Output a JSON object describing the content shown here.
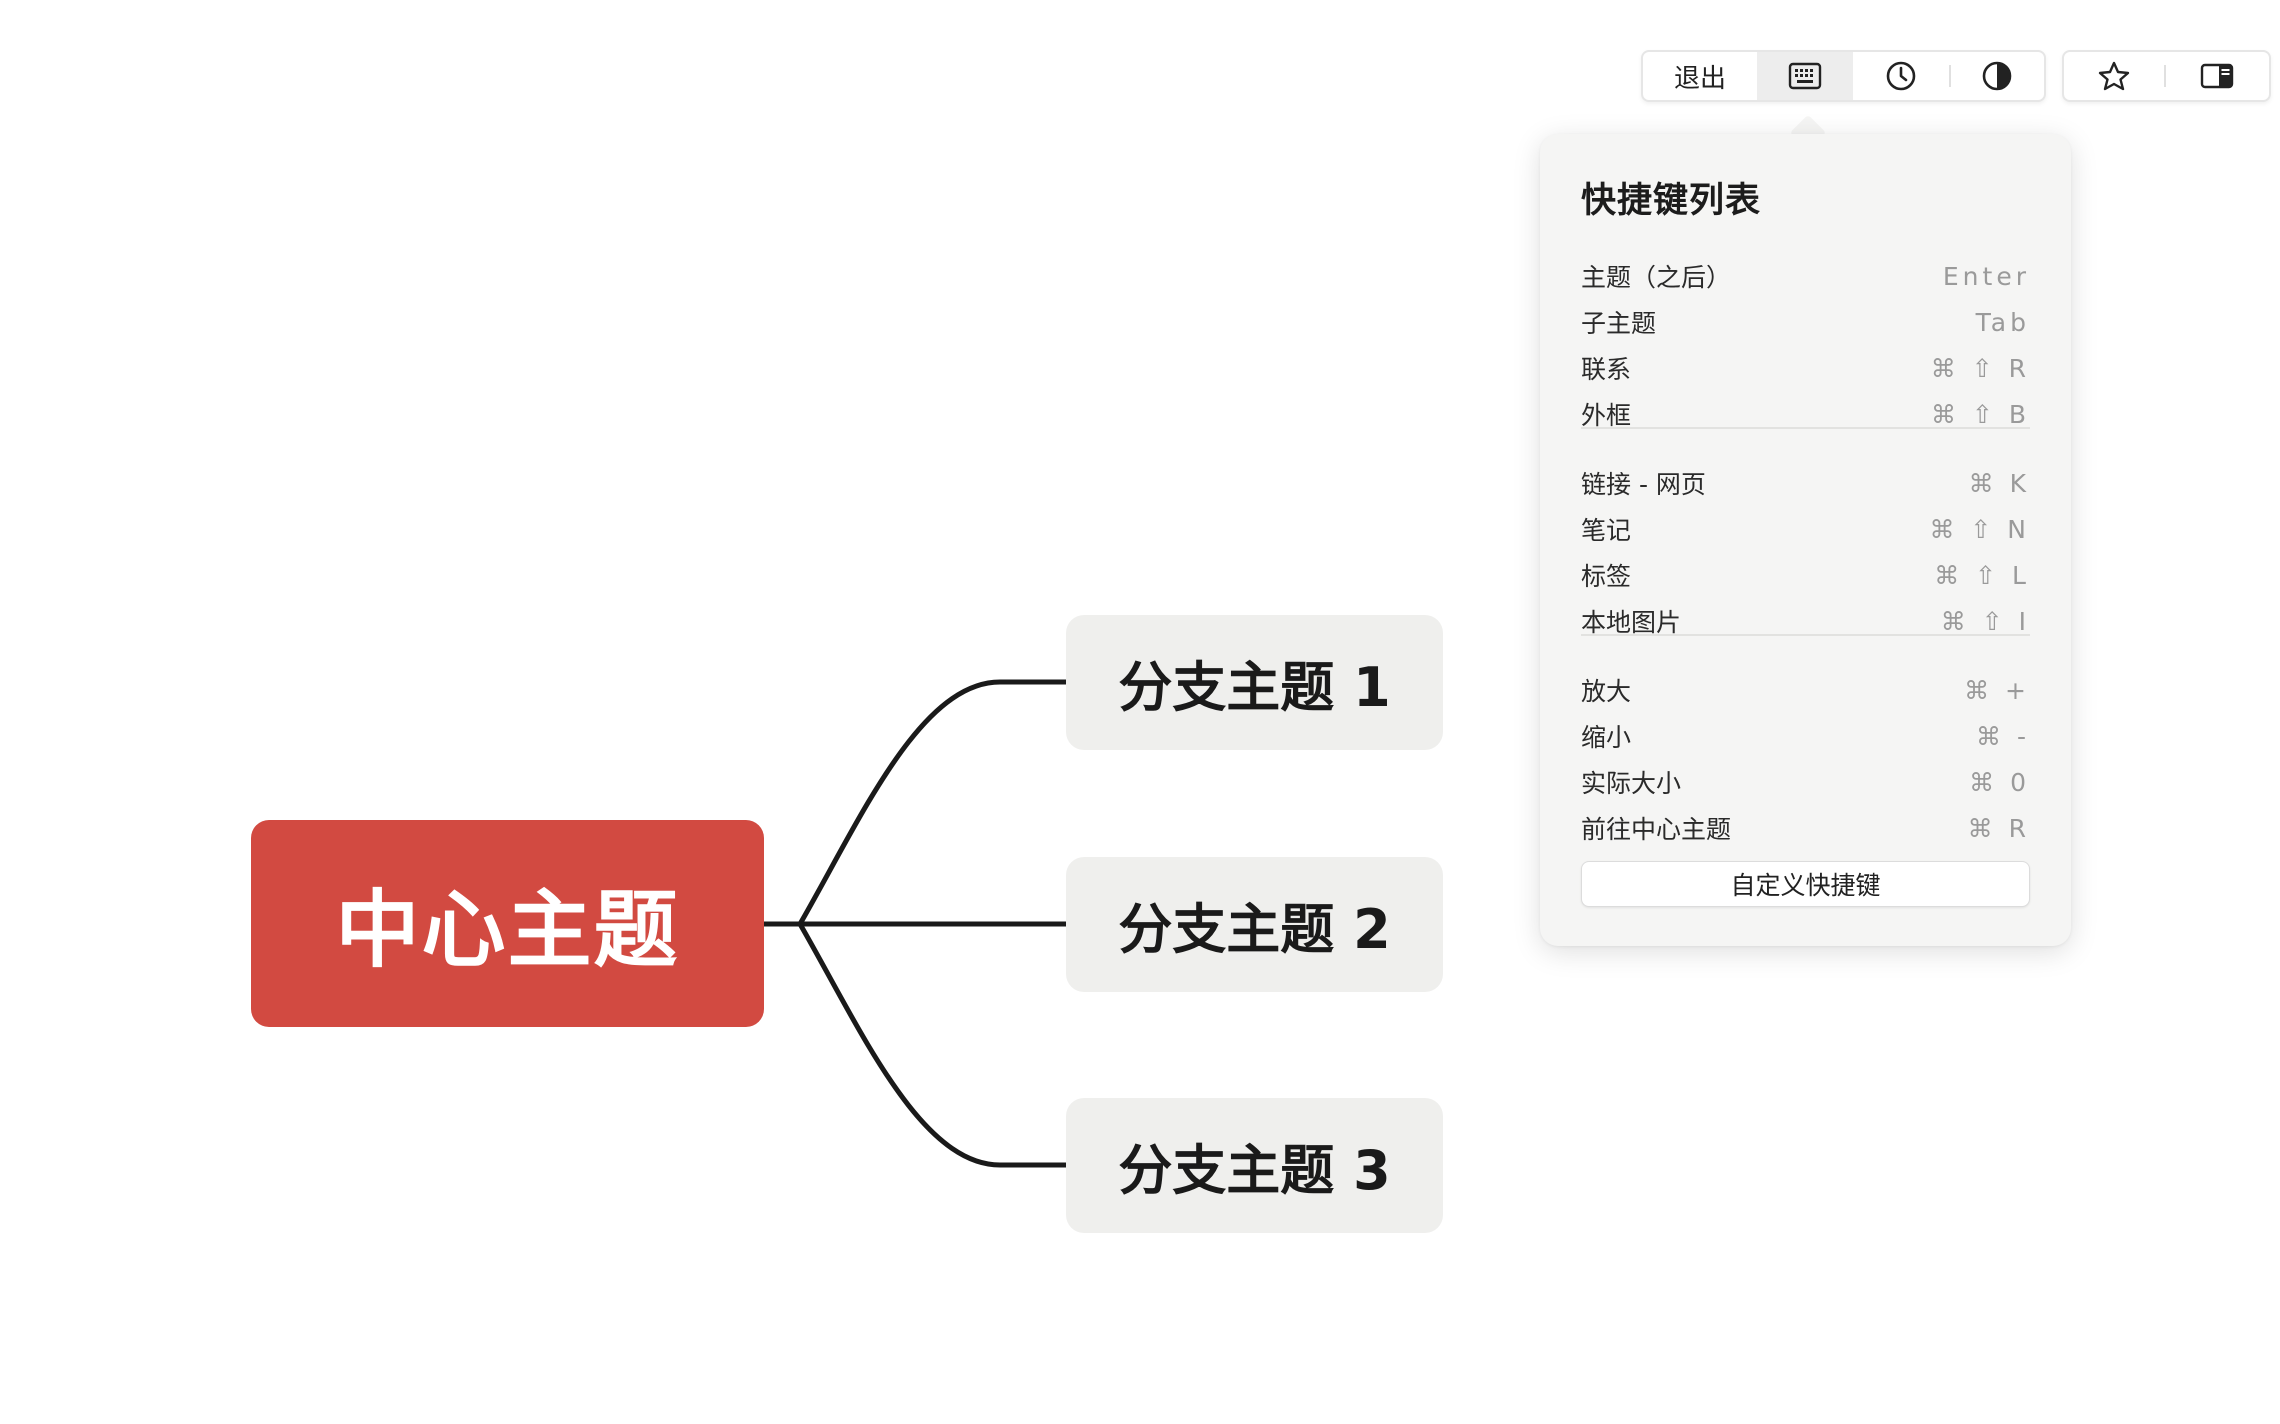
{
  "toolbar": {
    "exit_label": "退出",
    "icons": [
      "keyboard-icon",
      "clock-icon",
      "contrast-icon",
      "star-icon",
      "panel-icon"
    ]
  },
  "shortcuts": {
    "title": "快捷键列表",
    "groups": [
      [
        {
          "label": "主题（之后）",
          "key": "Enter"
        },
        {
          "label": "子主题",
          "key": "Tab"
        },
        {
          "label": "联系",
          "key": "⌘ ⇧ R"
        },
        {
          "label": "外框",
          "key": "⌘ ⇧ B"
        }
      ],
      [
        {
          "label": "链接 - 网页",
          "key": "⌘ K"
        },
        {
          "label": "笔记",
          "key": "⌘ ⇧ N"
        },
        {
          "label": "标签",
          "key": "⌘ ⇧ L"
        },
        {
          "label": "本地图片",
          "key": "⌘ ⇧ I"
        }
      ],
      [
        {
          "label": "放大",
          "key": "⌘ +"
        },
        {
          "label": "缩小",
          "key": "⌘ -"
        },
        {
          "label": "实际大小",
          "key": "⌘ 0"
        },
        {
          "label": "前往中心主题",
          "key": "⌘ R"
        }
      ]
    ],
    "custom_button": "自定义快捷键"
  },
  "mindmap": {
    "central": "中心主题",
    "branches": [
      "分支主题 1",
      "分支主题 2",
      "分支主题 3"
    ],
    "colors": {
      "central_fill": "#d24a41",
      "branch_fill": "#efefed",
      "line": "#1a1a1a"
    }
  }
}
